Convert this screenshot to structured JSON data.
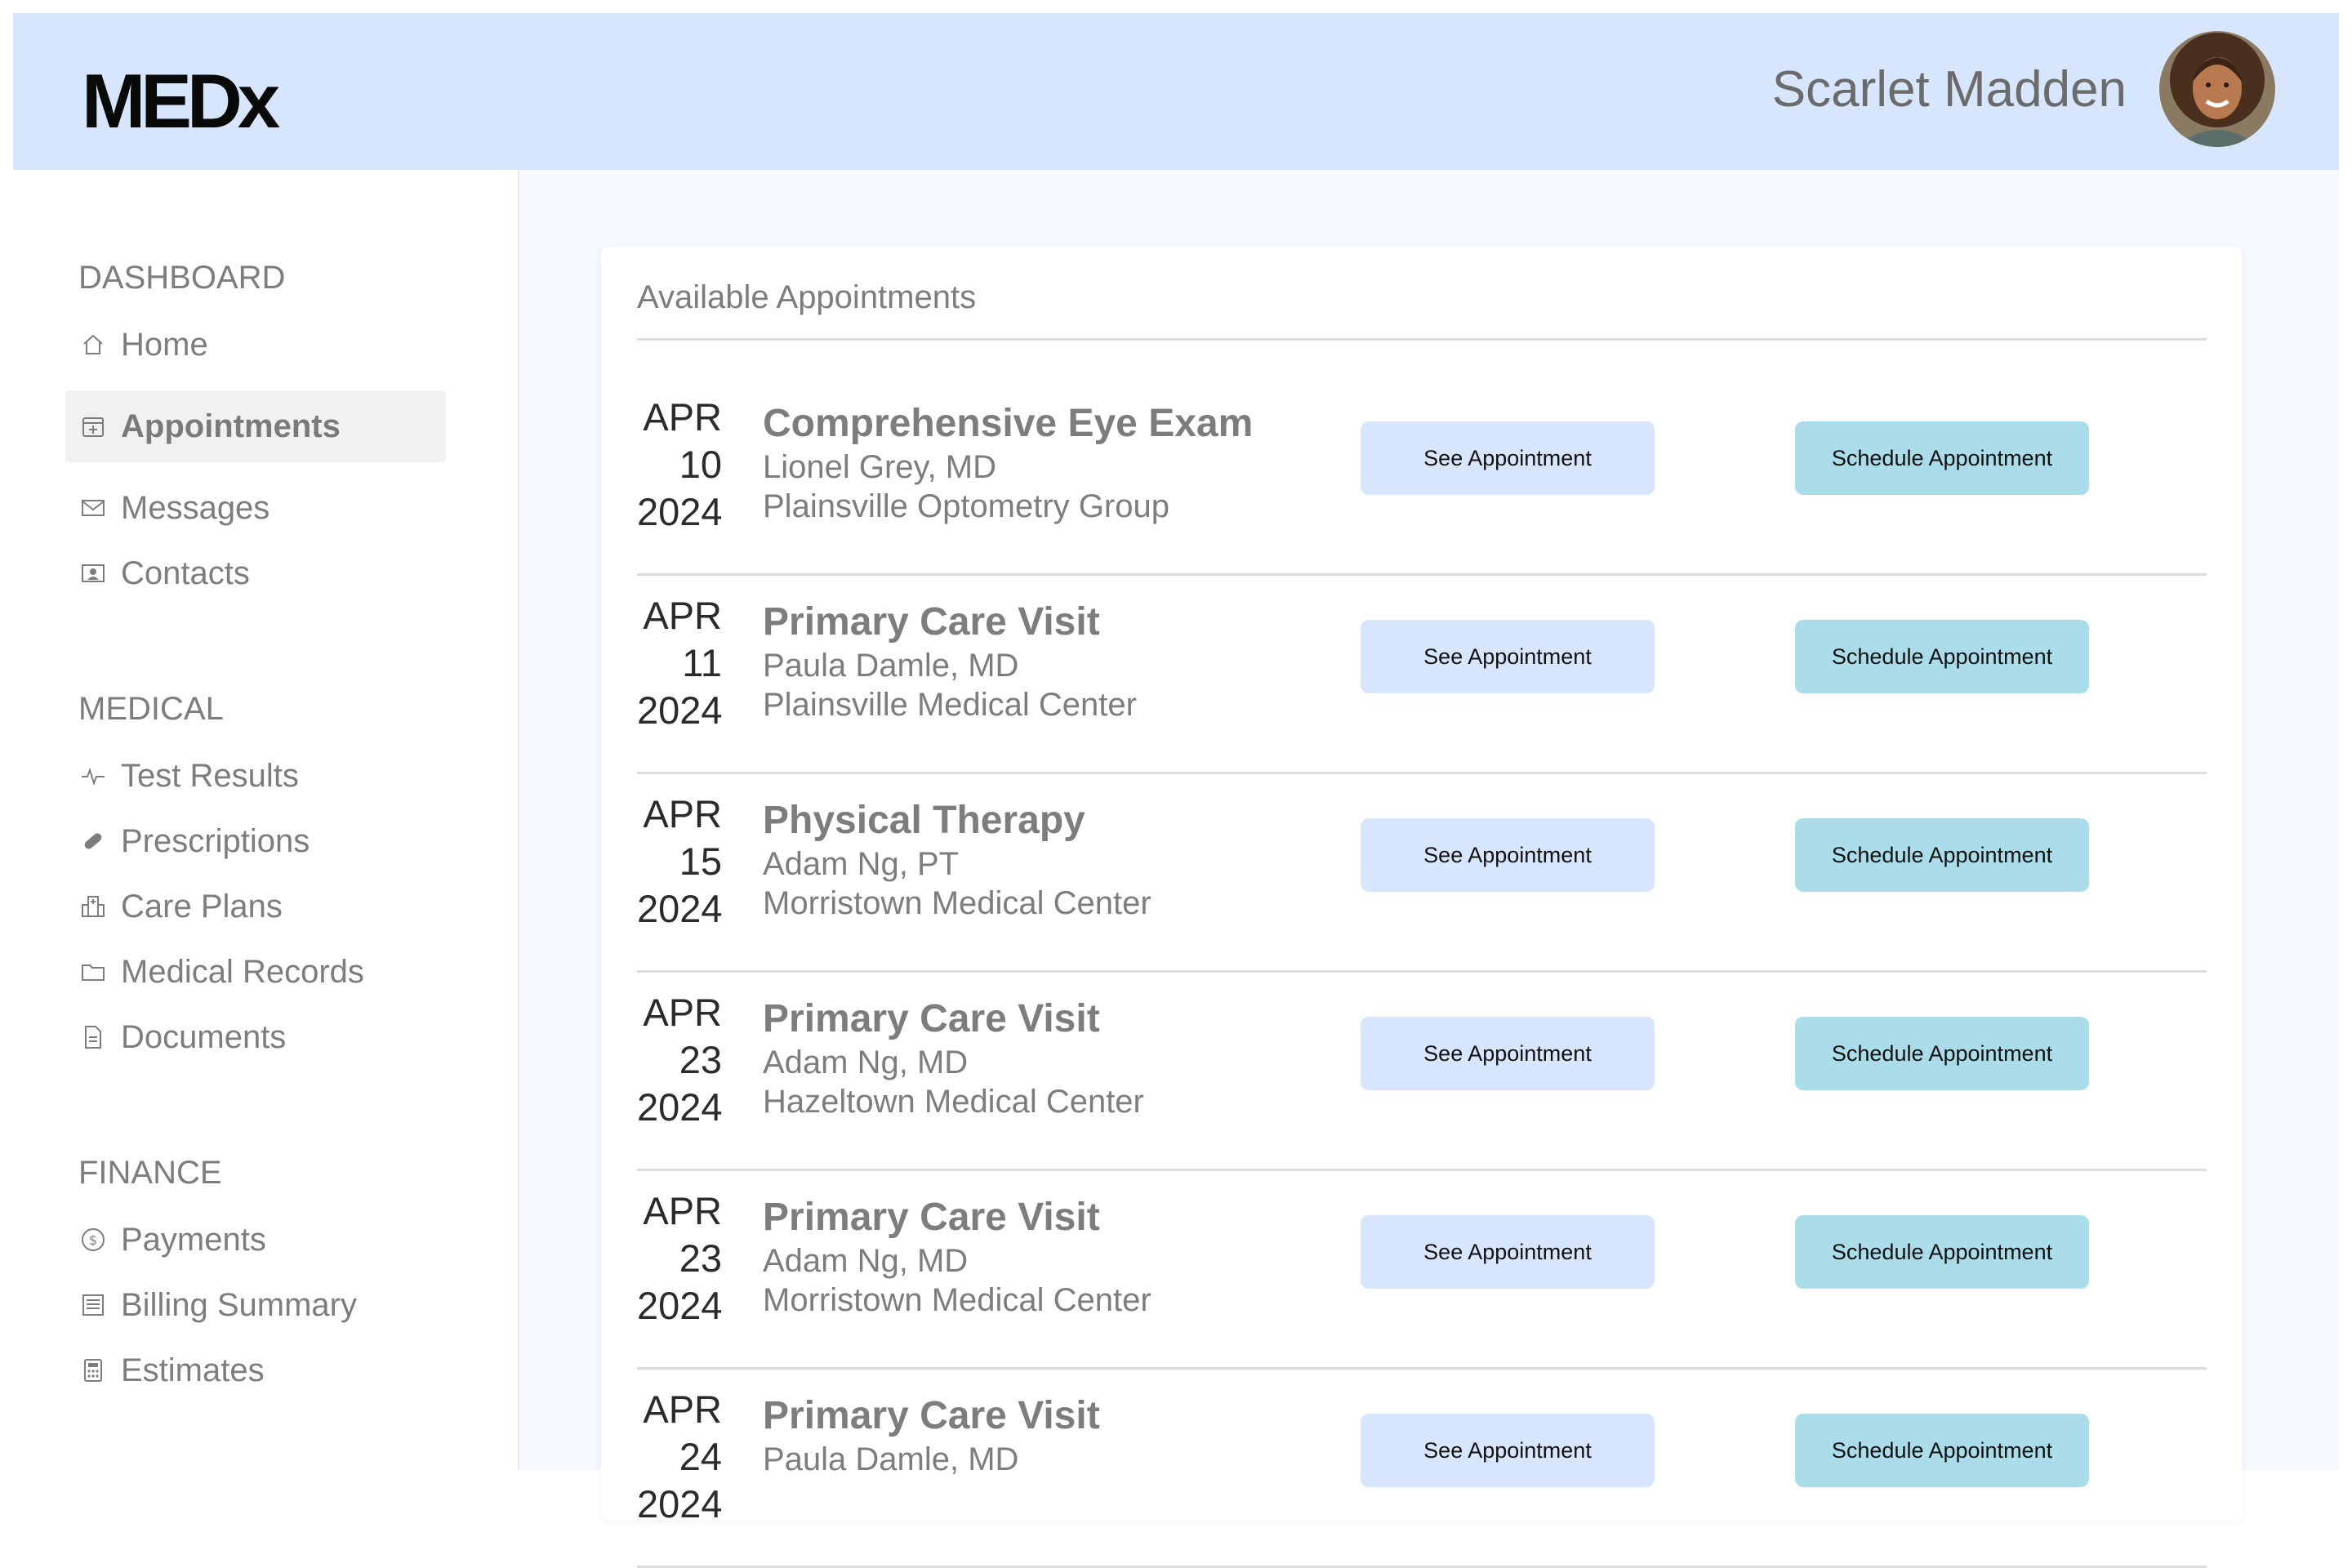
{
  "header": {
    "logo": "MEDx",
    "user_name": "Scarlet Madden"
  },
  "sidebar": {
    "sections": [
      {
        "title": "DASHBOARD",
        "items": [
          {
            "label": "Home",
            "icon": "home-icon"
          },
          {
            "label": "Appointments",
            "icon": "calendar-icon",
            "active": true
          },
          {
            "label": "Messages",
            "icon": "envelope-icon"
          },
          {
            "label": "Contacts",
            "icon": "contact-card-icon"
          }
        ]
      },
      {
        "title": "MEDICAL",
        "items": [
          {
            "label": "Test Results",
            "icon": "pulse-icon"
          },
          {
            "label": "Prescriptions",
            "icon": "pill-icon"
          },
          {
            "label": "Care Plans",
            "icon": "hospital-icon"
          },
          {
            "label": "Medical Records",
            "icon": "folder-icon"
          },
          {
            "label": "Documents",
            "icon": "document-icon"
          }
        ]
      },
      {
        "title": "FINANCE",
        "items": [
          {
            "label": "Payments",
            "icon": "dollar-coin-icon"
          },
          {
            "label": "Billing Summary",
            "icon": "ledger-icon"
          },
          {
            "label": "Estimates",
            "icon": "calculator-icon"
          }
        ]
      }
    ]
  },
  "main": {
    "card_title": "Available Appointments",
    "see_label": "See Appointment",
    "schedule_label": "Schedule Appointment",
    "appointments": [
      {
        "month": "APR",
        "day": "10",
        "year": "2024",
        "title": "Comprehensive Eye Exam",
        "doctor": "Lionel Grey, MD",
        "location": "Plainsville Optometry Group"
      },
      {
        "month": "APR",
        "day": "11",
        "year": "2024",
        "title": "Primary Care Visit",
        "doctor": "Paula Damle, MD",
        "location": "Plainsville Medical Center"
      },
      {
        "month": "APR",
        "day": "15",
        "year": "2024",
        "title": "Physical Therapy",
        "doctor": "Adam Ng, PT",
        "location": "Morristown Medical Center"
      },
      {
        "month": "APR",
        "day": "23",
        "year": "2024",
        "title": "Primary Care Visit",
        "doctor": "Adam Ng, MD",
        "location": "Hazeltown Medical Center"
      },
      {
        "month": "APR",
        "day": "23",
        "year": "2024",
        "title": "Primary Care Visit",
        "doctor": "Adam Ng, MD",
        "location": "Morristown Medical Center"
      },
      {
        "month": "APR",
        "day": "24",
        "year": "2024",
        "title": "Primary Care Visit",
        "doctor": "Paula Damle, MD",
        "location": ""
      }
    ]
  },
  "colors": {
    "header_bg": "#d7e5fd",
    "see_button": "#d7e5fd",
    "schedule_button": "#aadde9",
    "main_bg": "#f5f8fe"
  }
}
